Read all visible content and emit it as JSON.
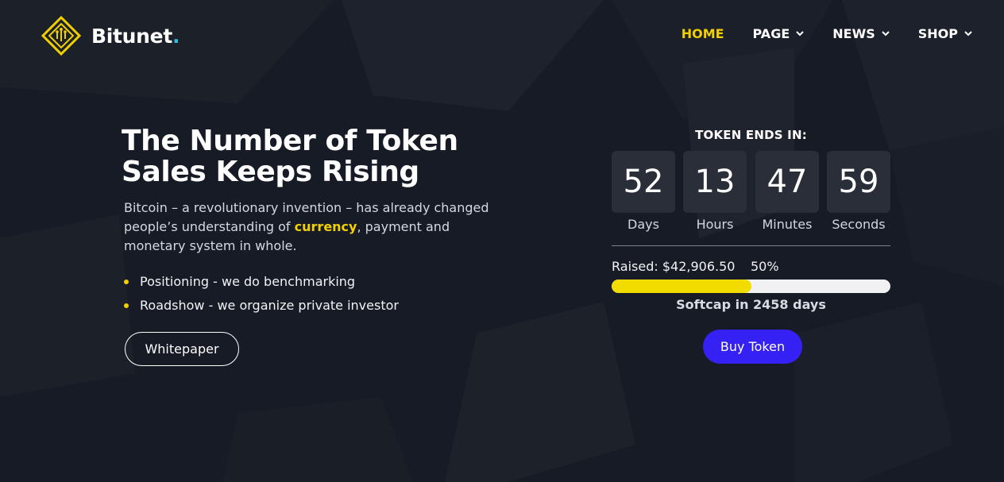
{
  "header": {
    "brand_name": "Bitunet",
    "brand_dot": ".",
    "nav": [
      {
        "label": "HOME",
        "active": true
      },
      {
        "label": "PAGE",
        "has_dropdown": true
      },
      {
        "label": "NEWS",
        "has_dropdown": true
      },
      {
        "label": "SHOP",
        "has_dropdown": true
      }
    ]
  },
  "hero": {
    "title": "The Number of Token Sales Keeps Rising",
    "desc_before": "Bitcoin – a revolutionary invention – has already changed people’s understanding of ",
    "desc_highlight": "currency",
    "desc_after": ", payment and monetary system in whole.",
    "bullets": [
      "Positioning - we do benchmarking",
      "Roadshow - we organize private investor"
    ],
    "whitepaper_label": "Whitepaper"
  },
  "token": {
    "title": "TOKEN ENDS IN:",
    "countdown": [
      {
        "value": "52",
        "label": "Days"
      },
      {
        "value": "13",
        "label": "Hours"
      },
      {
        "value": "47",
        "label": "Minutes"
      },
      {
        "value": "59",
        "label": "Seconds"
      }
    ],
    "raised_text": "Raised: $42,906.50",
    "percent_text": "50%",
    "progress_fraction": 0.5,
    "softcap_text": "Softcap in 2458 days",
    "buy_label": "Buy Token"
  },
  "colors": {
    "background": "#171b26",
    "accent_yellow": "#f2d000",
    "brand_dot": "#2fc0d8",
    "buy_button": "#3621f5",
    "countdown_box": "#2a2e39"
  },
  "icons": {
    "logo": "circuit-diamond-icon",
    "nav_dropdown": "chevron-down-icon",
    "bullet": "dot-icon"
  }
}
